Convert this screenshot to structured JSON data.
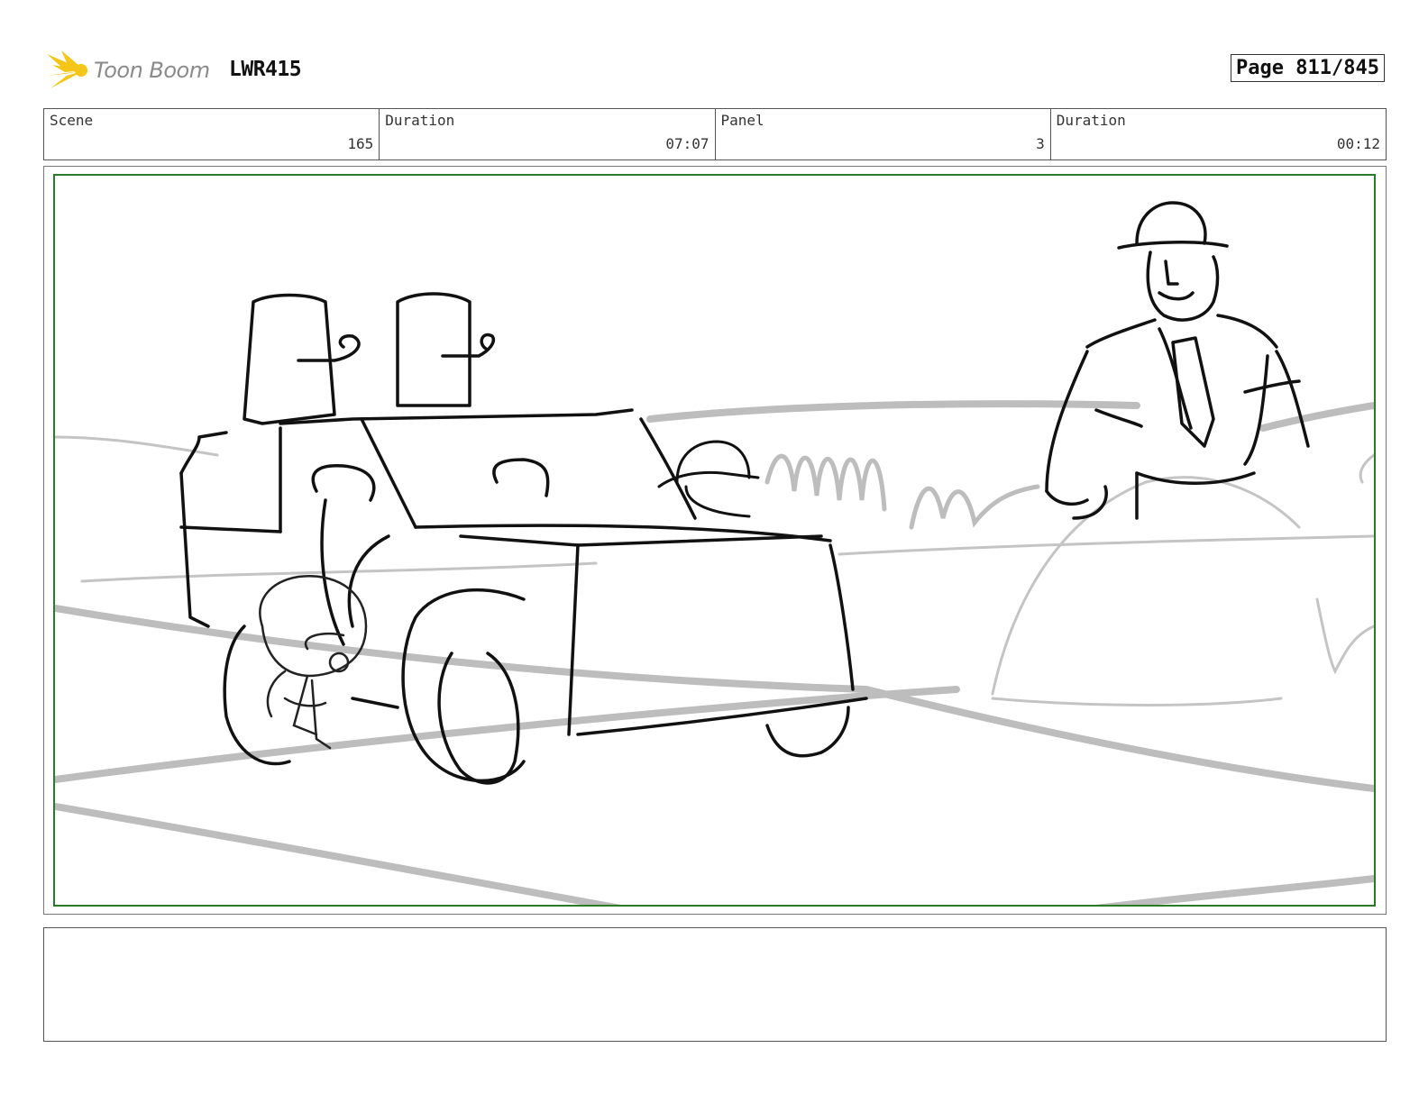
{
  "header": {
    "logo_text": "Toon Boom",
    "project": "LWR415",
    "page": "Page 811/845"
  },
  "info": [
    {
      "label": "Scene",
      "value": "165"
    },
    {
      "label": "Duration",
      "value": "07:07"
    },
    {
      "label": "Panel",
      "value": "3"
    },
    {
      "label": "Duration",
      "value": "00:12"
    }
  ],
  "colors": {
    "frame_green": "#2a7a2a",
    "logo_yellow": "#f5c518",
    "sketch_ink": "#111111",
    "background_sketch": "#bdbdbd"
  },
  "notes": {
    "text": ""
  }
}
